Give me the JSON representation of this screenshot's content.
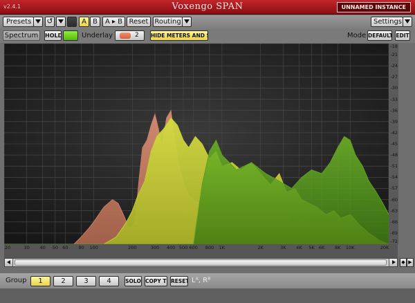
{
  "title_bar": {
    "version": "v2.4.1",
    "app_title": "Voxengo SPAN",
    "instance": "UNNAMED INSTANCE"
  },
  "toolbar": {
    "presets": "Presets",
    "ab_a": "A",
    "ab_b": "B",
    "ab_copy": "A ▸ B",
    "reset": "Reset",
    "routing": "Routing",
    "settings": "Settings"
  },
  "spectrum_bar": {
    "spectrum": "Spectrum",
    "hold": "HOLD",
    "underlay": "Underlay",
    "underlay_slot": "2",
    "hide_meters": "HIDE METERS AND STATS",
    "mode_label": "Mode",
    "mode_value": "DEFAULT",
    "edit": "EDIT"
  },
  "colors": {
    "primary_trace": "#c0cc32",
    "underlay_trace": "#c47c62",
    "secondary_trace": "#5fa01c",
    "hold_led": "#6fd21a",
    "underlay_led": "#e2704e"
  },
  "chart_data": {
    "type": "area",
    "x_scale": "log",
    "xlim": [
      20,
      20000
    ],
    "ylim": [
      -72,
      -18
    ],
    "x_ticks": [
      20,
      30,
      40,
      50,
      60,
      80,
      100,
      200,
      300,
      400,
      500,
      600,
      800,
      1000,
      2000,
      3000,
      4000,
      5000,
      6000,
      8000,
      10000,
      20000
    ],
    "x_tick_labels": [
      "20",
      "30",
      "40",
      "50",
      "60",
      "80",
      "100",
      "200",
      "300",
      "400",
      "500",
      "600",
      "800",
      "1K",
      "2K",
      "3K",
      "4K",
      "5K",
      "6K",
      "8K",
      "10K",
      "20K"
    ],
    "y_ticks": [
      -18,
      -21,
      -24,
      -27,
      -30,
      -33,
      -36,
      -39,
      -42,
      -45,
      -48,
      -51,
      -54,
      -57,
      -60,
      -63,
      -66,
      -69,
      -72
    ],
    "grid": true,
    "series": [
      {
        "role": "underlay",
        "x": [
          20,
          70,
          80,
          90,
          100,
          120,
          140,
          155,
          170,
          190,
          210,
          225,
          240,
          260,
          280,
          300,
          320,
          340,
          370,
          400,
          430,
          470,
          520,
          560,
          600,
          650,
          700,
          760,
          820,
          900,
          1000,
          1100,
          1300,
          1500,
          1800,
          2100,
          2500,
          3000,
          3600,
          4300,
          5000,
          6000,
          7000,
          8000,
          10000,
          13000,
          16000,
          20000
        ],
        "y": [
          -72,
          -72,
          -70,
          -68,
          -66,
          -62,
          -60,
          -61,
          -64,
          -68,
          -66,
          -55,
          -46,
          -44,
          -40,
          -37,
          -41,
          -46,
          -38,
          -36,
          -44,
          -52,
          -57,
          -59,
          -60,
          -61,
          -62,
          -60,
          -61,
          -62,
          -64,
          -63,
          -62,
          -64,
          -63,
          -65,
          -64,
          -63,
          -66,
          -65,
          -67,
          -66,
          -67,
          -68,
          -69,
          -70,
          -71,
          -72
        ]
      },
      {
        "role": "primary",
        "x": [
          20,
          120,
          150,
          180,
          200,
          220,
          250,
          280,
          310,
          350,
          400,
          450,
          500,
          550,
          620,
          700,
          800,
          900,
          1000,
          1200,
          1400,
          1700,
          2000,
          2400,
          2800,
          3200,
          3700,
          4200,
          4800,
          5500,
          6500,
          7500,
          8500,
          10000,
          12000,
          14000,
          17000,
          20000
        ],
        "y": [
          -72,
          -72,
          -70,
          -66,
          -63,
          -59,
          -55,
          -47,
          -43,
          -41,
          -38,
          -40,
          -44,
          -46,
          -43,
          -45,
          -49,
          -47,
          -51,
          -50,
          -52,
          -50,
          -53,
          -56,
          -53,
          -58,
          -57,
          -60,
          -61,
          -62,
          -64,
          -63,
          -65,
          -64,
          -67,
          -69,
          -71,
          -72
        ]
      },
      {
        "role": "secondary",
        "x": [
          20,
          600,
          700,
          800,
          900,
          1000,
          1300,
          1700,
          2200,
          2800,
          3500,
          4200,
          5000,
          6000,
          7000,
          8000,
          9000,
          10000,
          11000,
          12500,
          14000,
          16000,
          18000,
          20000
        ],
        "y": [
          -72,
          -72,
          -56,
          -47,
          -44,
          -48,
          -52,
          -50,
          -53,
          -55,
          -57,
          -54,
          -52,
          -53,
          -50,
          -46,
          -43,
          -44,
          -48,
          -51,
          -55,
          -58,
          -61,
          -64
        ]
      }
    ]
  },
  "group_bar": {
    "label": "Group",
    "groups": [
      "1",
      "2",
      "3",
      "4"
    ],
    "solo": "SOLO",
    "copy_to": "COPY TO",
    "reset": "RESET",
    "channels": "Lᴬ, Rᴮ"
  }
}
